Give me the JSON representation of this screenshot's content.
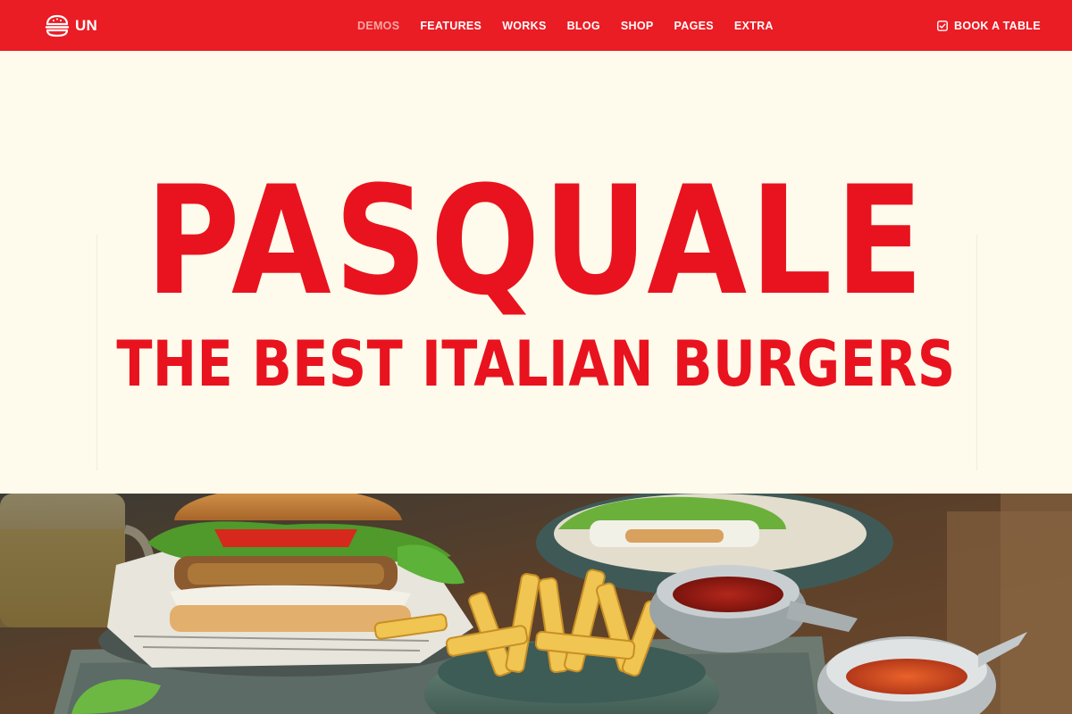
{
  "header": {
    "logo_text": "UN",
    "nav": [
      {
        "label": "DEMOS",
        "active": true
      },
      {
        "label": "FEATURES",
        "active": false
      },
      {
        "label": "WORKS",
        "active": false
      },
      {
        "label": "BLOG",
        "active": false
      },
      {
        "label": "SHOP",
        "active": false
      },
      {
        "label": "PAGES",
        "active": false
      },
      {
        "label": "EXTRA",
        "active": false
      }
    ],
    "book_label": "BOOK A TABLE"
  },
  "hero": {
    "title": "PASQUALE",
    "subtitle": "THE BEST ITALIAN BURGERS"
  },
  "icons": {
    "logo": "burger-icon",
    "book": "calendar-check-icon"
  },
  "colors": {
    "brand_red": "#ea1c24",
    "title_red": "#e8131e",
    "cream": "#fefaec",
    "nav_active": "#f6a8a3"
  }
}
